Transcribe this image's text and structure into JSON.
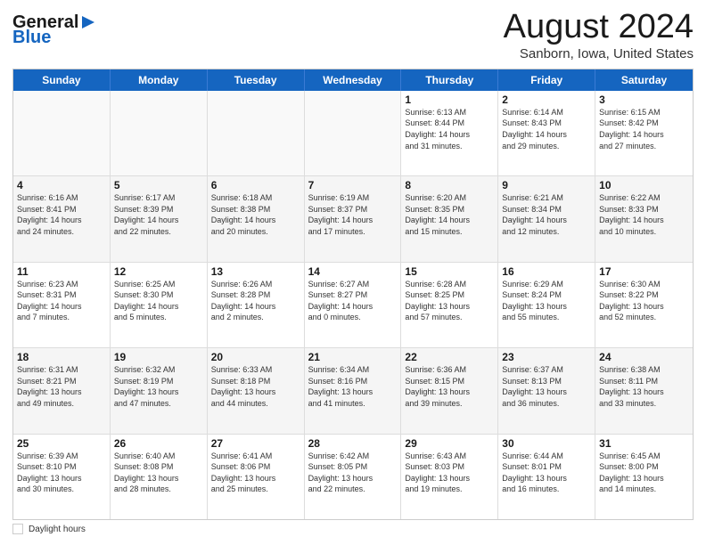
{
  "header": {
    "logo_line1": "General",
    "logo_line2": "Blue",
    "title": "August 2024",
    "subtitle": "Sanborn, Iowa, United States"
  },
  "days_of_week": [
    "Sunday",
    "Monday",
    "Tuesday",
    "Wednesday",
    "Thursday",
    "Friday",
    "Saturday"
  ],
  "rows": [
    {
      "cells": [
        {
          "day": "",
          "text": ""
        },
        {
          "day": "",
          "text": ""
        },
        {
          "day": "",
          "text": ""
        },
        {
          "day": "",
          "text": ""
        },
        {
          "day": "1",
          "text": "Sunrise: 6:13 AM\nSunset: 8:44 PM\nDaylight: 14 hours\nand 31 minutes."
        },
        {
          "day": "2",
          "text": "Sunrise: 6:14 AM\nSunset: 8:43 PM\nDaylight: 14 hours\nand 29 minutes."
        },
        {
          "day": "3",
          "text": "Sunrise: 6:15 AM\nSunset: 8:42 PM\nDaylight: 14 hours\nand 27 minutes."
        }
      ]
    },
    {
      "cells": [
        {
          "day": "4",
          "text": "Sunrise: 6:16 AM\nSunset: 8:41 PM\nDaylight: 14 hours\nand 24 minutes."
        },
        {
          "day": "5",
          "text": "Sunrise: 6:17 AM\nSunset: 8:39 PM\nDaylight: 14 hours\nand 22 minutes."
        },
        {
          "day": "6",
          "text": "Sunrise: 6:18 AM\nSunset: 8:38 PM\nDaylight: 14 hours\nand 20 minutes."
        },
        {
          "day": "7",
          "text": "Sunrise: 6:19 AM\nSunset: 8:37 PM\nDaylight: 14 hours\nand 17 minutes."
        },
        {
          "day": "8",
          "text": "Sunrise: 6:20 AM\nSunset: 8:35 PM\nDaylight: 14 hours\nand 15 minutes."
        },
        {
          "day": "9",
          "text": "Sunrise: 6:21 AM\nSunset: 8:34 PM\nDaylight: 14 hours\nand 12 minutes."
        },
        {
          "day": "10",
          "text": "Sunrise: 6:22 AM\nSunset: 8:33 PM\nDaylight: 14 hours\nand 10 minutes."
        }
      ]
    },
    {
      "cells": [
        {
          "day": "11",
          "text": "Sunrise: 6:23 AM\nSunset: 8:31 PM\nDaylight: 14 hours\nand 7 minutes."
        },
        {
          "day": "12",
          "text": "Sunrise: 6:25 AM\nSunset: 8:30 PM\nDaylight: 14 hours\nand 5 minutes."
        },
        {
          "day": "13",
          "text": "Sunrise: 6:26 AM\nSunset: 8:28 PM\nDaylight: 14 hours\nand 2 minutes."
        },
        {
          "day": "14",
          "text": "Sunrise: 6:27 AM\nSunset: 8:27 PM\nDaylight: 14 hours\nand 0 minutes."
        },
        {
          "day": "15",
          "text": "Sunrise: 6:28 AM\nSunset: 8:25 PM\nDaylight: 13 hours\nand 57 minutes."
        },
        {
          "day": "16",
          "text": "Sunrise: 6:29 AM\nSunset: 8:24 PM\nDaylight: 13 hours\nand 55 minutes."
        },
        {
          "day": "17",
          "text": "Sunrise: 6:30 AM\nSunset: 8:22 PM\nDaylight: 13 hours\nand 52 minutes."
        }
      ]
    },
    {
      "cells": [
        {
          "day": "18",
          "text": "Sunrise: 6:31 AM\nSunset: 8:21 PM\nDaylight: 13 hours\nand 49 minutes."
        },
        {
          "day": "19",
          "text": "Sunrise: 6:32 AM\nSunset: 8:19 PM\nDaylight: 13 hours\nand 47 minutes."
        },
        {
          "day": "20",
          "text": "Sunrise: 6:33 AM\nSunset: 8:18 PM\nDaylight: 13 hours\nand 44 minutes."
        },
        {
          "day": "21",
          "text": "Sunrise: 6:34 AM\nSunset: 8:16 PM\nDaylight: 13 hours\nand 41 minutes."
        },
        {
          "day": "22",
          "text": "Sunrise: 6:36 AM\nSunset: 8:15 PM\nDaylight: 13 hours\nand 39 minutes."
        },
        {
          "day": "23",
          "text": "Sunrise: 6:37 AM\nSunset: 8:13 PM\nDaylight: 13 hours\nand 36 minutes."
        },
        {
          "day": "24",
          "text": "Sunrise: 6:38 AM\nSunset: 8:11 PM\nDaylight: 13 hours\nand 33 minutes."
        }
      ]
    },
    {
      "cells": [
        {
          "day": "25",
          "text": "Sunrise: 6:39 AM\nSunset: 8:10 PM\nDaylight: 13 hours\nand 30 minutes."
        },
        {
          "day": "26",
          "text": "Sunrise: 6:40 AM\nSunset: 8:08 PM\nDaylight: 13 hours\nand 28 minutes."
        },
        {
          "day": "27",
          "text": "Sunrise: 6:41 AM\nSunset: 8:06 PM\nDaylight: 13 hours\nand 25 minutes."
        },
        {
          "day": "28",
          "text": "Sunrise: 6:42 AM\nSunset: 8:05 PM\nDaylight: 13 hours\nand 22 minutes."
        },
        {
          "day": "29",
          "text": "Sunrise: 6:43 AM\nSunset: 8:03 PM\nDaylight: 13 hours\nand 19 minutes."
        },
        {
          "day": "30",
          "text": "Sunrise: 6:44 AM\nSunset: 8:01 PM\nDaylight: 13 hours\nand 16 minutes."
        },
        {
          "day": "31",
          "text": "Sunrise: 6:45 AM\nSunset: 8:00 PM\nDaylight: 13 hours\nand 14 minutes."
        }
      ]
    }
  ],
  "footer": {
    "daylight_label": "Daylight hours"
  }
}
